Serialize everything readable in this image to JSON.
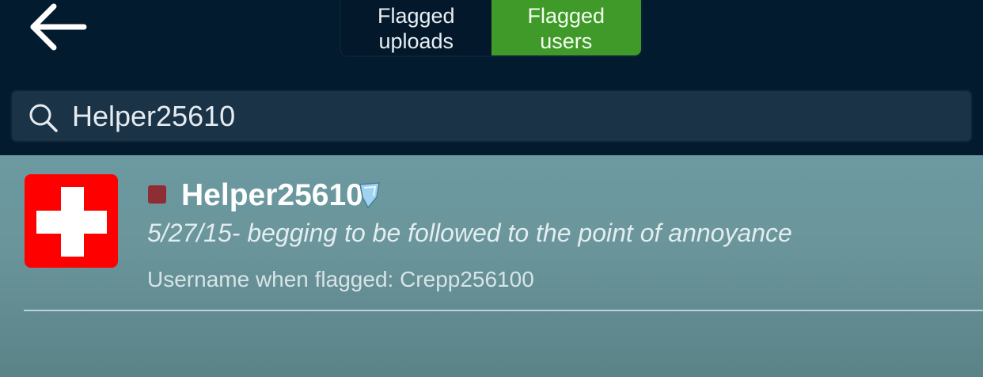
{
  "header": {
    "back_icon": "arrow-left-icon",
    "tabs": [
      {
        "label": "Flagged\nuploads",
        "active": false
      },
      {
        "label": "Flagged\nusers",
        "active": true
      }
    ]
  },
  "search": {
    "icon": "search-icon",
    "value": "Helper25610",
    "placeholder": ""
  },
  "results": [
    {
      "username": "Helper25610",
      "status_color": "#8e2d33",
      "avatar": "swiss-cross-icon",
      "badge_icon": "shield-badge-icon",
      "reason": "5/27/15- begging to be followed to the point of annoyance",
      "flagged_username": "Username when flagged: Crepp256100"
    }
  ],
  "colors": {
    "header_bg": "#021b2f",
    "tab_active": "#3f9a2a",
    "avatar_red": "#ff0000",
    "content_bg": "#6b9aa0"
  }
}
